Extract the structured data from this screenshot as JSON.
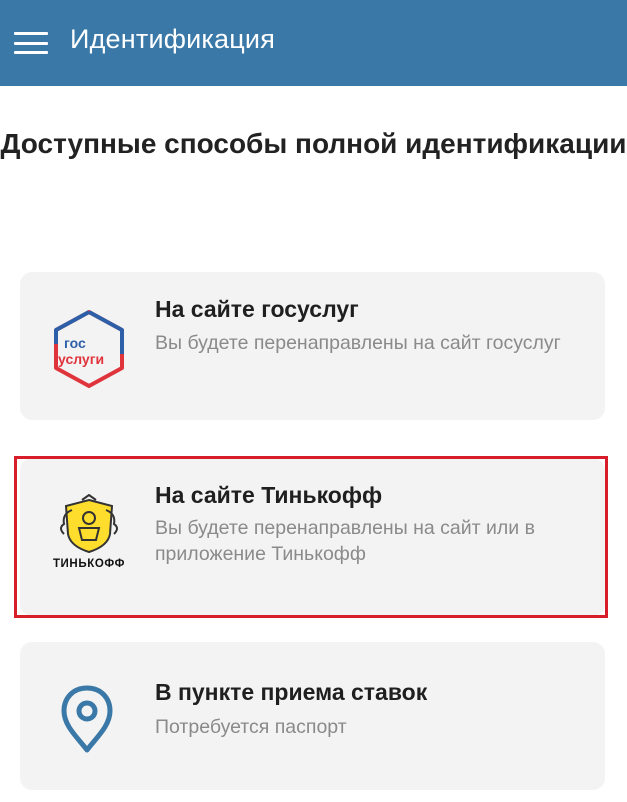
{
  "appbar": {
    "title": "Идентификация",
    "menu_icon": "hamburger-menu-icon"
  },
  "heading": "Доступные способы полной идентификации",
  "options": [
    {
      "title": "На сайте госуслуг",
      "description": "Вы будете перенаправлены на сайт госуслуг",
      "icon": "gosuslugi-logo",
      "logo_text_line1": "гос",
      "logo_text_line2": "услуги"
    },
    {
      "title": "На сайте Тинькофф",
      "description": "Вы будете перенаправлены на сайт или в приложение Тинькофф",
      "icon": "tinkoff-logo",
      "logo_text": "ТИНЬКОФФ",
      "highlighted": true
    },
    {
      "title": "В пункте приема ставок",
      "description": "Потребуется паспорт",
      "icon": "location-pin-icon"
    }
  ],
  "colors": {
    "appbar": "#3a78a8",
    "card_bg": "#f3f3f3",
    "highlight": "#d71d2a",
    "gos_blue": "#2d5fa8",
    "gos_red": "#e0343d",
    "pin": "#3a78a8",
    "tinkoff_yellow": "#ffdd2d"
  }
}
